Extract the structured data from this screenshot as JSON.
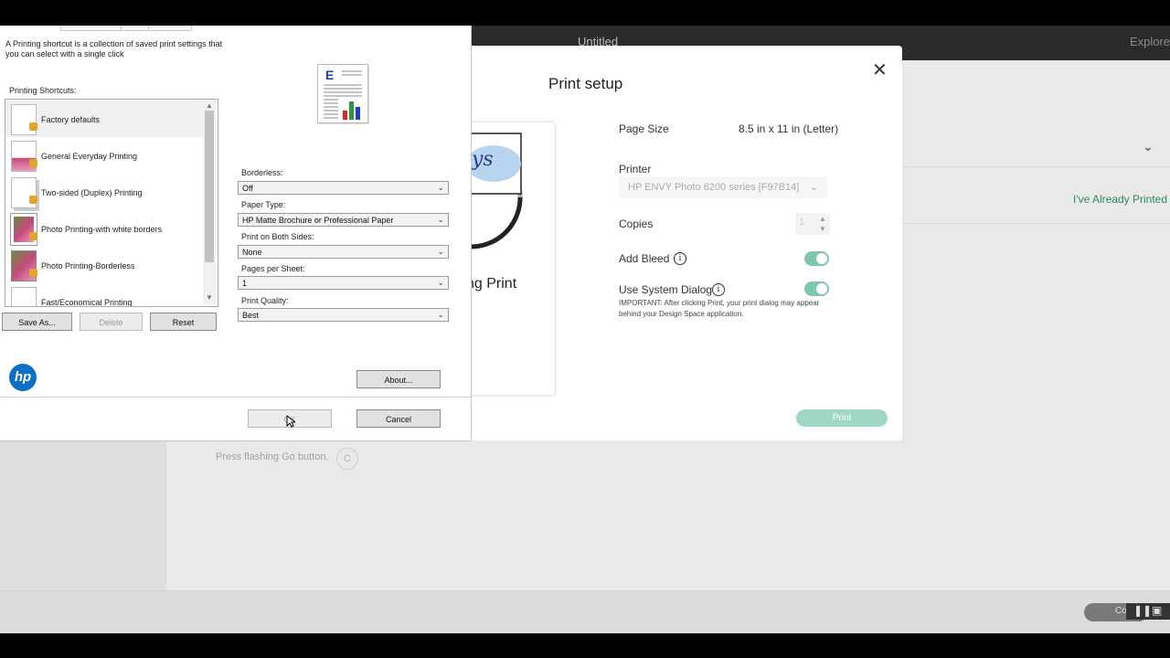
{
  "app": {
    "title": "Untitled",
    "explore": "Explore",
    "already_printed": "I've Already Printed",
    "press_go": "Press flashing Go button.",
    "spinner_glyph": "C",
    "footer_pill_text": "Co"
  },
  "print_setup": {
    "title": "Print setup",
    "page_size_label": "Page Size",
    "page_size_value": "8.5 in x 11 in (Letter)",
    "printer_label": "Printer",
    "printer_value": "HP ENVY Photo 6200 series [F97B14]",
    "copies_label": "Copies",
    "copies_value": "1",
    "add_bleed_label": "Add Bleed",
    "add_bleed_on": true,
    "use_system_dialog_label": "Use System Dialog",
    "use_system_dialog_on": true,
    "important_note": "IMPORTANT: After clicking Print, your print dialog may appear behind your Design Space application.",
    "print_button": "Print",
    "preview_text": "ng Print",
    "preview_logo_text": "ys",
    "colors": {
      "accent": "#7fc6ae",
      "print_button": "#9fd7c4"
    }
  },
  "hp_dialog": {
    "description": "A Printing shortcut is a collection of saved print settings that you can select with a single click",
    "shortcuts_label": "Printing Shortcuts:",
    "shortcuts": [
      {
        "label": "Factory defaults",
        "thumb": "blank",
        "selected": true
      },
      {
        "label": "General Everyday Printing",
        "thumb": "mixed",
        "selected": false
      },
      {
        "label": "Two-sided (Duplex) Printing",
        "thumb": "duplex",
        "selected": false
      },
      {
        "label": "Photo Printing-with white borders",
        "thumb": "photo",
        "selected": false
      },
      {
        "label": "Photo Printing-Borderless",
        "thumb": "photo",
        "selected": false
      },
      {
        "label": "Fast/Economical Printing",
        "thumb": "blank",
        "selected": false
      }
    ],
    "save_as": "Save As...",
    "delete": "Delete",
    "reset": "Reset",
    "borderless_label": "Borderless:",
    "borderless_value": "Off",
    "paper_type_label": "Paper Type:",
    "paper_type_value": "HP Matte Brochure or Professional Paper",
    "both_sides_label": "Print on Both Sides:",
    "both_sides_value": "None",
    "pages_per_sheet_label": "Pages per Sheet:",
    "pages_per_sheet_value": "1",
    "print_quality_label": "Print Quality:",
    "print_quality_value": "Best",
    "about": "About...",
    "ok": "OK",
    "cancel": "Cancel",
    "preview_letter": "E",
    "logo_text": "hp"
  }
}
